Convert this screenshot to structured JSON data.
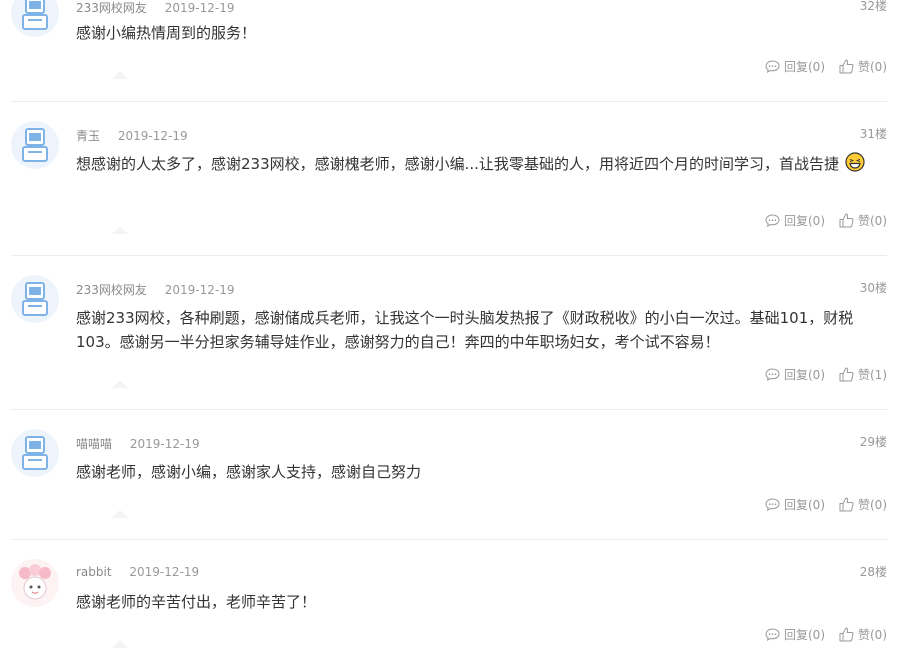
{
  "comments": [
    {
      "user": "233网校网友",
      "date": "2019-12-19",
      "floor": "32楼",
      "text": "感谢小编热情周到的服务！",
      "reply_label": "回复(0)",
      "like_label": "赞(0)",
      "avatar": "robot-avatar"
    },
    {
      "user": "青玉",
      "date": "2019-12-19",
      "floor": "31楼",
      "text": "想感谢的人太多了，感谢233网校，感谢槐老师，感谢小编...让我零基础的人，用将近四个月的时间学习，首战告捷",
      "reply_label": "回复(0)",
      "like_label": "赞(0)",
      "avatar": "robot-avatar"
    },
    {
      "user": "233网校网友",
      "date": "2019-12-19",
      "floor": "30楼",
      "text": "感谢233网校，各种刷题，感谢储成兵老师，让我这个一时头脑发热报了《财政税收》的小白一次过。基础101，财税103。感谢另一半分担家务辅导娃作业，感谢努力的自己！奔四的中年职场妇女，考个试不容易！",
      "reply_label": "回复(0)",
      "like_label": "赞(1)",
      "avatar": "robot-avatar"
    },
    {
      "user": "喵喵喵",
      "date": "2019-12-19",
      "floor": "29楼",
      "text": "感谢老师，感谢小编，感谢家人支持，感谢自己努力",
      "reply_label": "回复(0)",
      "like_label": "赞(0)",
      "avatar": "robot-avatar"
    },
    {
      "user": "rabbit",
      "date": "2019-12-19",
      "floor": "28楼",
      "text": "感谢老师的辛苦付出，老师辛苦了！",
      "reply_label": "回复(0)",
      "like_label": "赞(0)",
      "avatar": "cartoon-avatar"
    }
  ],
  "colors": {
    "text": "#333333",
    "meta": "#999999",
    "divider": "#ececec",
    "avatar_blue": "#7fb2e6"
  },
  "icons": {
    "reply": "comment-bubble-icon",
    "like": "thumbs-up-icon",
    "emoji": "laughing-face-emoji"
  }
}
